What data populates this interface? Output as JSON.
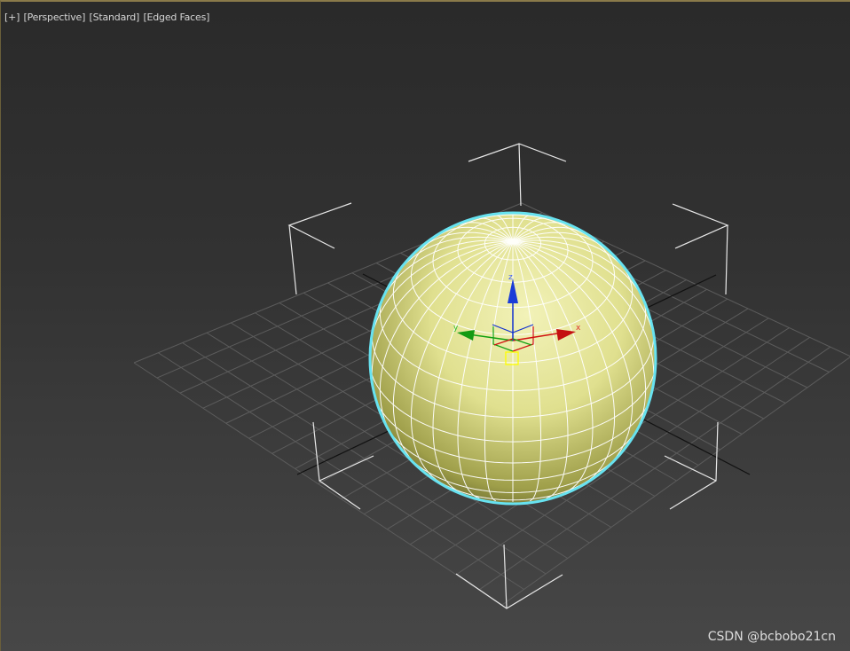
{
  "viewport": {
    "menu_label": "[+]",
    "view_label": "[Perspective]",
    "shading_label": "[Standard]",
    "display_label": "[Edged Faces]"
  },
  "gizmo": {
    "x_axis_label": "x",
    "y_axis_label": "y",
    "z_axis_label": "z"
  },
  "watermark": "CSDN @bcbobo21cn",
  "colors": {
    "sphere_fill": "#e6e699",
    "selection_outline": "#67e2f0",
    "x_axis": "#d01010",
    "y_axis": "#10a010",
    "z_axis": "#1030d0",
    "pivot_box": "#ffff00",
    "grid": "#5a5a5a"
  }
}
